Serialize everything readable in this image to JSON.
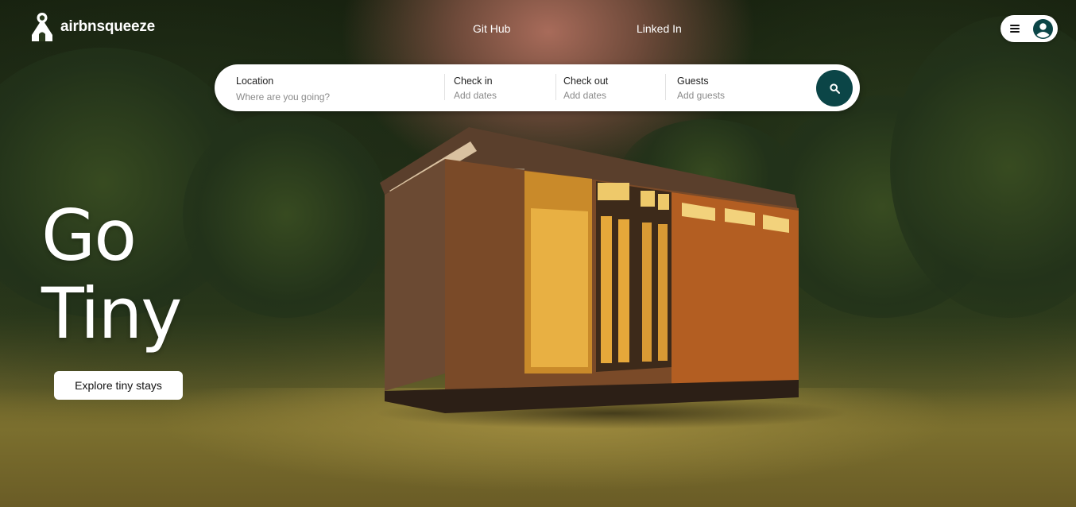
{
  "brand": {
    "name": "airbnsqueeze",
    "logo_icon": "house-logo-icon"
  },
  "nav": {
    "github": "Git Hub",
    "linkedin": "Linked In"
  },
  "user_menu": {
    "menu_icon": "hamburger-icon",
    "avatar_icon": "user-avatar-icon"
  },
  "search": {
    "location": {
      "label": "Location",
      "placeholder": "Where are you going?"
    },
    "check_in": {
      "label": "Check in",
      "placeholder": "Add dates"
    },
    "check_out": {
      "label": "Check out",
      "placeholder": "Add dates"
    },
    "guests": {
      "label": "Guests",
      "placeholder": "Add guests"
    },
    "button_icon": "search-icon"
  },
  "hero": {
    "title_line1": "Go",
    "title_line2": "Tiny",
    "cta_label": "Explore tiny stays"
  },
  "colors": {
    "search_button": "#0b4547",
    "text_on_image": "#ffffff"
  }
}
